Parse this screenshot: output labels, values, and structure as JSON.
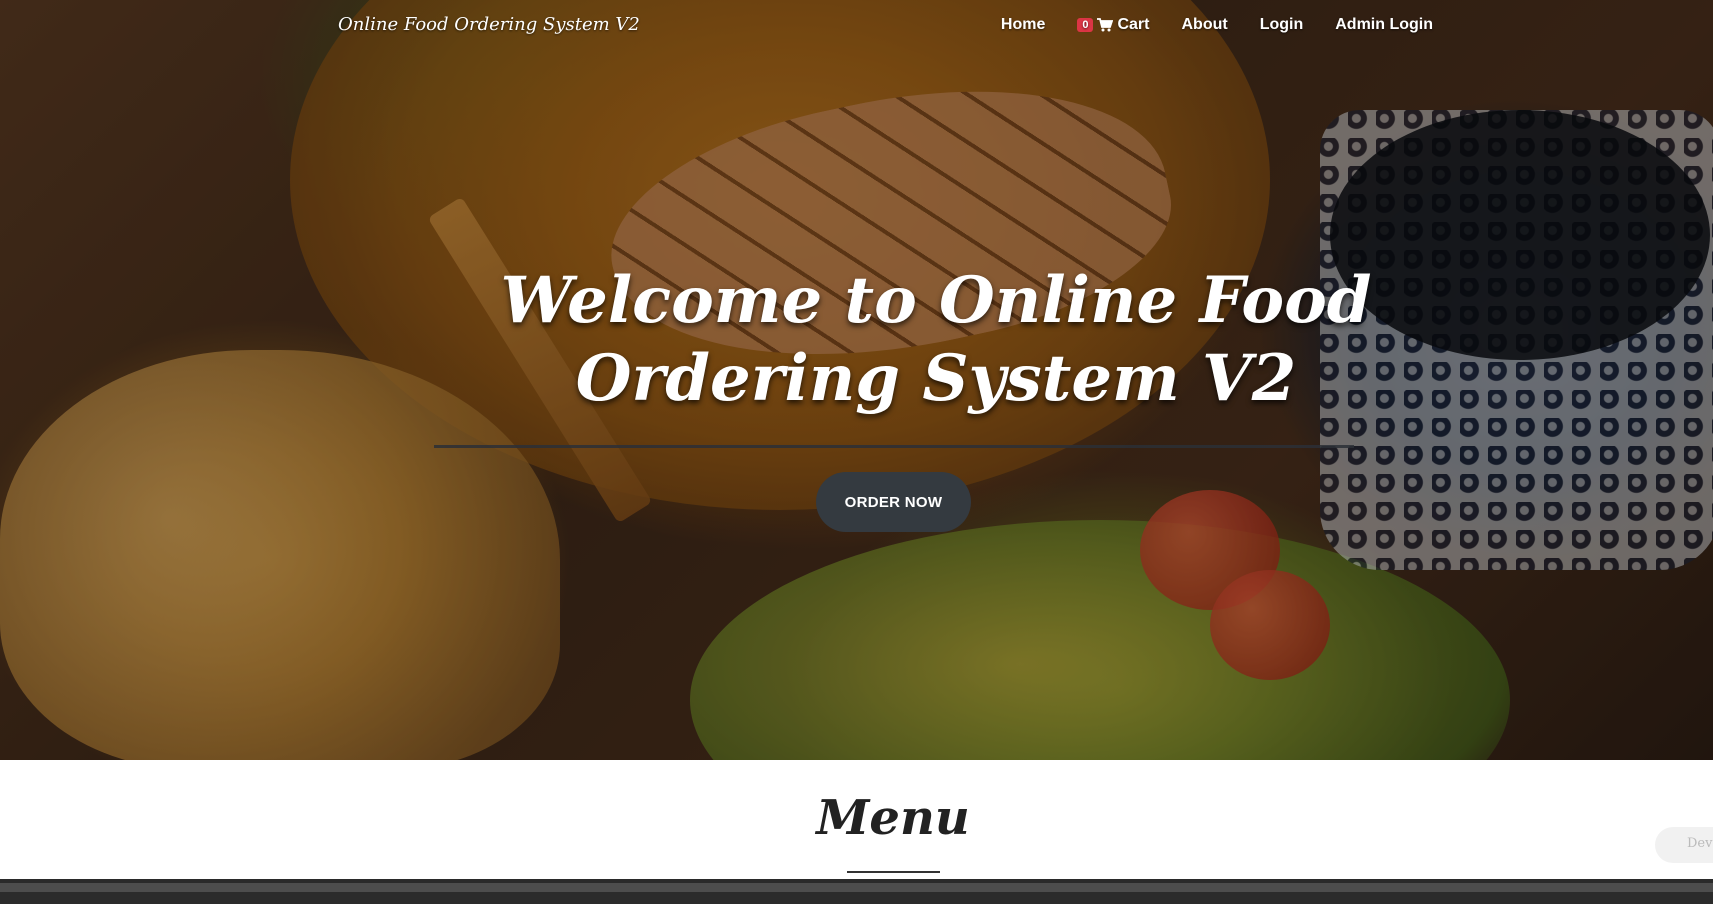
{
  "navbar": {
    "brand": "Online Food Ordering System V2",
    "links": {
      "home": "Home",
      "cart_count": "0",
      "cart": "Cart",
      "about": "About",
      "login": "Login",
      "admin_login": "Admin Login"
    }
  },
  "hero": {
    "title": "Welcome to Online Food Ordering System V2",
    "button": "ORDER NOW"
  },
  "menu": {
    "title": "Menu"
  },
  "widget": {
    "label": "Deve"
  },
  "colors": {
    "button_bg": "#343a40",
    "badge_bg": "#dc3545"
  },
  "icons": [
    "cart-icon"
  ]
}
